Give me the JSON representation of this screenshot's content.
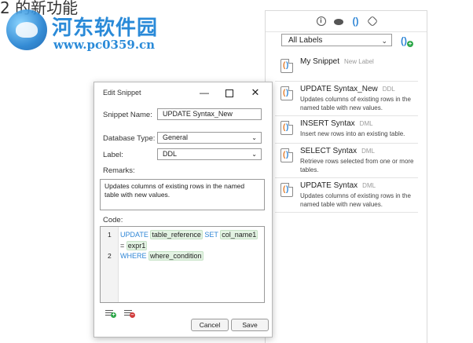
{
  "watermark": {
    "top_text": "2 的新功能",
    "site_name_cn": "河东软件园",
    "site_url": "www.pc0359.cn"
  },
  "panel": {
    "toolbar_icons": [
      "info-icon",
      "eye-icon",
      "braces-icon",
      "settings-icon"
    ],
    "labels_select_value": "All Labels",
    "snippets": [
      {
        "title": "My Snippet",
        "tag": "New Label",
        "desc": ""
      },
      {
        "title": "UPDATE Syntax_New",
        "tag": "DDL",
        "desc": "Updates columns of existing rows in the named table with new values."
      },
      {
        "title": "INSERT Syntax",
        "tag": "DML",
        "desc": "Insert new rows into an existing table."
      },
      {
        "title": "SELECT Syntax",
        "tag": "DML",
        "desc": "Retrieve rows selected from one or more tables."
      },
      {
        "title": "UPDATE Syntax",
        "tag": "DML",
        "desc": "Updates columns of existing rows in the named table with new values."
      }
    ]
  },
  "dialog": {
    "title": "Edit Snippet",
    "snippet_name_label": "Snippet Name:",
    "snippet_name_value": "UPDATE Syntax_New",
    "db_type_label": "Database Type:",
    "db_type_value": "General",
    "label_label": "Label:",
    "label_value": "DDL",
    "remarks_label": "Remarks:",
    "remarks_value": "Updates columns of existing rows in the named table with new values.",
    "code_label": "Code:",
    "code": {
      "line1_no": "1",
      "line2_no": "2",
      "kw_update": "UPDATE",
      "id_table_ref": "table_reference",
      "kw_set": "SET",
      "id_col_name": "col_name1",
      "op_eq": "=",
      "id_expr": "expr1",
      "kw_where": "WHERE",
      "id_where_cond": "where_condition"
    },
    "cancel_label": "Cancel",
    "save_label": "Save"
  },
  "colors": {
    "keyword": "#2f86d6",
    "identifier_bg": "#e3f3e3",
    "add_green": "#2ea84a",
    "remove_red": "#d23b3b"
  }
}
